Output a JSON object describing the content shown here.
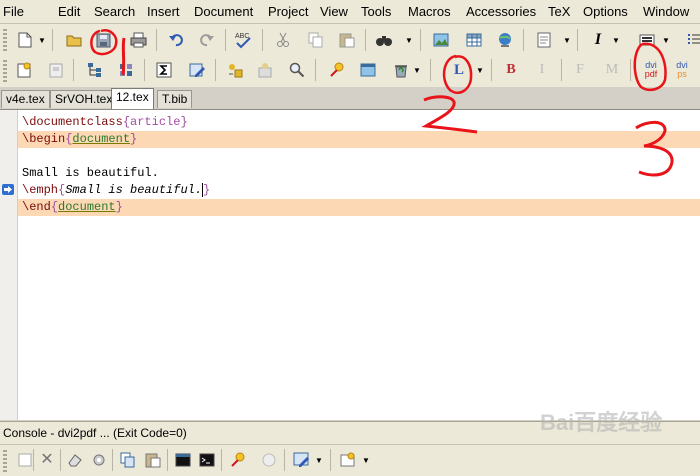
{
  "menu": [
    "File",
    "Edit",
    "Search",
    "Insert",
    "Document",
    "Project",
    "View",
    "Tools",
    "Macros",
    "Accessories",
    "TeX",
    "Options",
    "Window"
  ],
  "toolbar1": {
    "icons": [
      "new-file-icon",
      "open-folder-icon",
      "save-icon",
      "print-icon",
      "undo-icon",
      "redo-icon",
      "spellcheck-icon",
      "cut-icon",
      "copy-icon",
      "paste-icon",
      "find-icon",
      "image-icon",
      "table-icon",
      "web-icon",
      "document-icon",
      "italic-icon",
      "format-icon",
      "list-icon"
    ],
    "spell_label": "ABC",
    "italic_label": "I"
  },
  "toolbar2": {
    "icons": [
      "new-project-icon",
      "close-project-icon",
      "structure-icon",
      "module-icon",
      "sum-icon",
      "edit-icon",
      "macro-icon",
      "insert-icon",
      "search-icon",
      "color-pick-icon",
      "window-icon",
      "recycle-icon",
      "latex-icon",
      "bold-icon",
      "italic-format-icon",
      "font-icon",
      "math-icon",
      "dvi-pdf-icon",
      "dvi-ps-icon"
    ],
    "latex_label": "L",
    "bold_label": "B",
    "italic_label": "I",
    "font_label": "F",
    "math_label": "M",
    "dvipdf_top": "dvi",
    "dvipdf_bottom": "pdf",
    "dvips_top": "dvi",
    "dvips_bottom": "ps"
  },
  "tabs": [
    {
      "label": "v4e.tex",
      "active": false
    },
    {
      "label": "SrVOH.tex",
      "active": false
    },
    {
      "label": "12.tex",
      "active": true
    },
    {
      "label": "T.bib",
      "active": false
    }
  ],
  "editor": {
    "line1": {
      "cmd": "\\documentclass",
      "open": "{",
      "arg": "article",
      "close": "}"
    },
    "line2": {
      "cmd": "\\begin",
      "open": "{",
      "arg": "document",
      "close": "}"
    },
    "line3": "",
    "line4": "Small is beautiful.",
    "line5": {
      "cmd": "\\emph",
      "open": "{",
      "arg": "Small is beautiful.",
      "close": "}"
    },
    "line6": {
      "cmd": "\\end",
      "open": "{",
      "arg": "document",
      "close": "}"
    }
  },
  "status": {
    "text": "Console - dvi2pdf ... (Exit Code=0)"
  },
  "watermark": "Bai百度经验",
  "annotations": {
    "one": "1",
    "two": "2",
    "three": "3"
  },
  "colors": {
    "highlight_line": "#fdd8b5",
    "annotation_red": "#e8141a",
    "env_green": "#2a7a2a"
  }
}
